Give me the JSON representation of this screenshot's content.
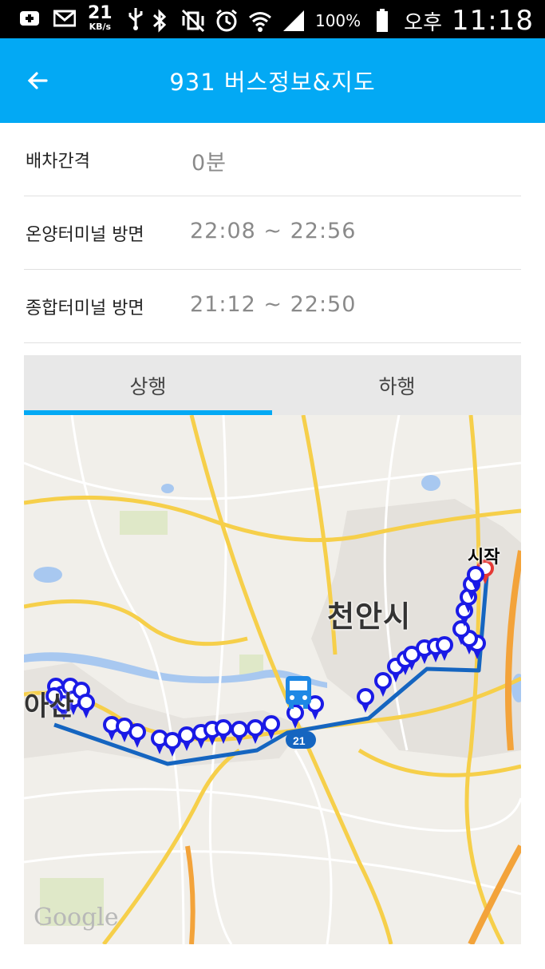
{
  "status_bar": {
    "net_speed": "21",
    "net_unit": "KB/s",
    "battery": "100%",
    "ampm": "오후",
    "time": "11:18"
  },
  "app_bar": {
    "title": "931 버스정보&지도"
  },
  "info_rows": [
    {
      "label": "배차간격",
      "value": "0분"
    },
    {
      "label": "온양터미널 방면",
      "value": "22:08 ~ 22:56"
    },
    {
      "label": "종합터미널 방면",
      "value": "21:12 ~ 22:50"
    }
  ],
  "tabs": [
    {
      "label": "상행",
      "selected": true
    },
    {
      "label": "하행",
      "selected": false
    }
  ],
  "map": {
    "city_label": "천안시",
    "city_label_partial": "아산",
    "start_label": "시작",
    "bus_number": "21",
    "attribution": "Google",
    "route_color": "#1565C0",
    "marker_color": "#1A1AE6",
    "start_marker_color": "#E53935"
  },
  "colors": {
    "accent": "#03A9F4",
    "status_bar": "#000000"
  }
}
